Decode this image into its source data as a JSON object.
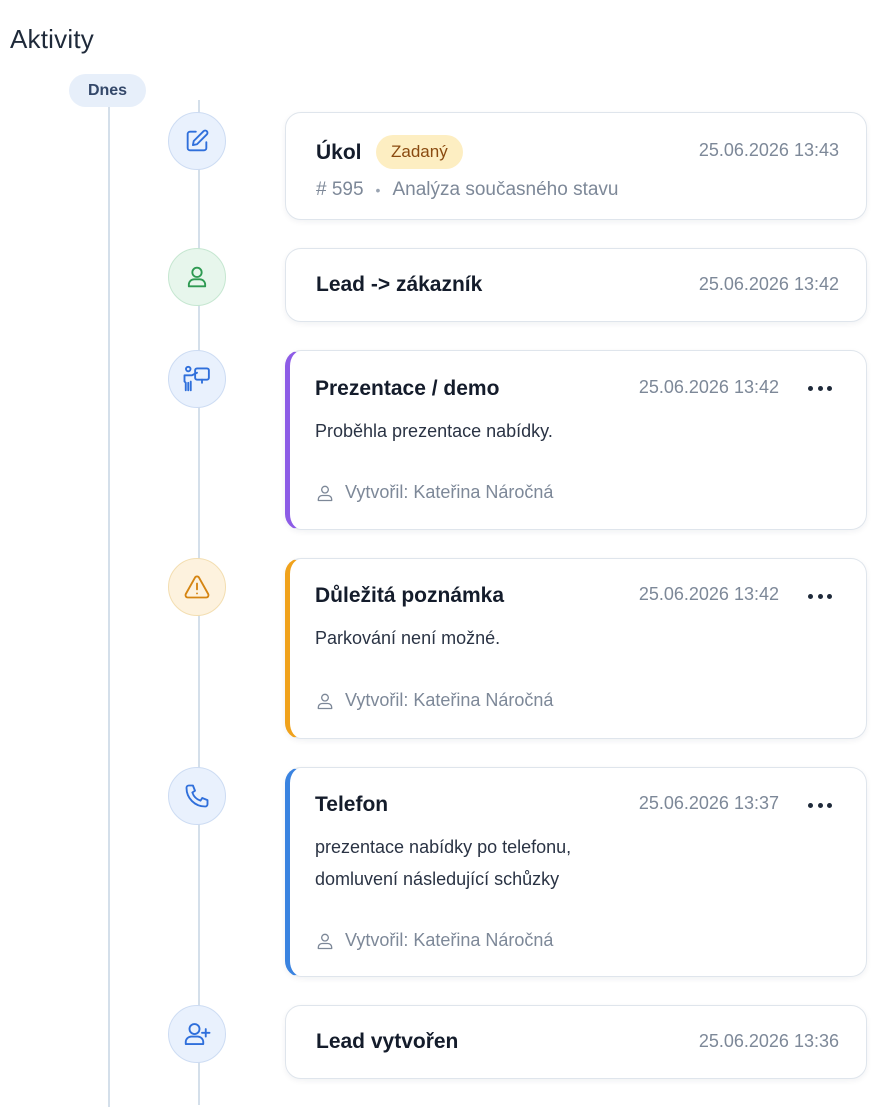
{
  "page": {
    "title": "Aktivity"
  },
  "timeline": {
    "day_label": "Dnes",
    "items": [
      {
        "type": "task",
        "title": "Úkol",
        "status": "Zadaný",
        "time": "25.06.2026 13:43",
        "number": "# 595",
        "separator": "•",
        "subject": "Analýza současného stavu",
        "icon": "edit-icon"
      },
      {
        "type": "conversion",
        "title": "Lead -> zákazník",
        "time": "25.06.2026 13:42",
        "icon": "user-icon"
      },
      {
        "type": "presentation",
        "title": "Prezentace / demo",
        "time": "25.06.2026 13:42",
        "body": "Proběhla prezentace nabídky.",
        "creator_label": "Vytvořil:",
        "creator_name": "Kateřina Náročná",
        "icon": "presentation-icon",
        "accent": "#8d5ce6"
      },
      {
        "type": "important-note",
        "title": "Důležitá poznámka",
        "time": "25.06.2026 13:42",
        "body": "Parkování není možné.",
        "creator_label": "Vytvořil:",
        "creator_name": "Kateřina Náročná",
        "icon": "warning-icon",
        "accent": "#f0a21c"
      },
      {
        "type": "phone",
        "title": "Telefon",
        "time": "25.06.2026 13:37",
        "body_lines": [
          "prezentace nabídky po telefonu,",
          "domluvení následující schůzky"
        ],
        "creator_label": "Vytvořil:",
        "creator_name": "Kateřina Náročná",
        "icon": "phone-icon",
        "accent": "#3a83e0"
      },
      {
        "type": "lead-created",
        "title": "Lead vytvořen",
        "time": "25.06.2026 13:36",
        "icon": "user-add-icon"
      }
    ]
  },
  "colors": {
    "marker_blue": "#e9f1fd",
    "marker_green": "#e7f6ec",
    "marker_amber": "#fdf2de",
    "icon_blue": "#2f6fdb",
    "icon_green": "#2e9a52",
    "icon_amber": "#d58512",
    "badge_bg": "#fdeec2",
    "badge_text": "#8a4a10"
  }
}
